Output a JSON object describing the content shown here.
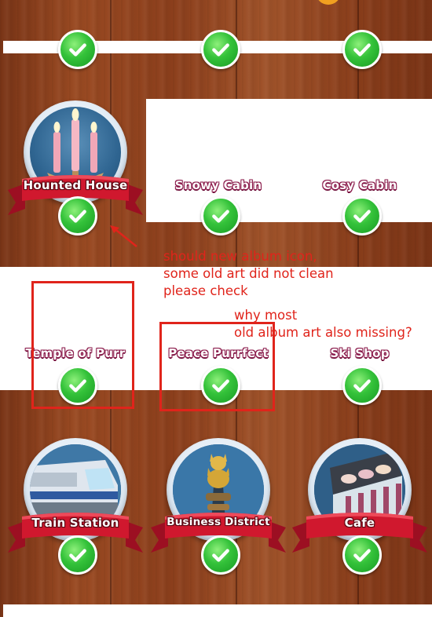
{
  "albums": {
    "row2": [
      {
        "title": "Hounted House",
        "completed": true,
        "icon": "candles-art"
      },
      {
        "title": "Snowy Cabin",
        "completed": true,
        "icon": ""
      },
      {
        "title": "Cosy Cabin",
        "completed": true,
        "icon": ""
      }
    ],
    "row3": [
      {
        "title": "Temple of Purr",
        "completed": true,
        "icon": ""
      },
      {
        "title": "Peace Purrfect",
        "completed": true,
        "icon": ""
      },
      {
        "title": "Ski Shop",
        "completed": true,
        "icon": ""
      }
    ],
    "row4": [
      {
        "title": "Train Station",
        "completed": true,
        "icon": "train-art"
      },
      {
        "title": "Business District",
        "completed": true,
        "icon": "cat-statue-art"
      },
      {
        "title": "Cafe",
        "completed": true,
        "icon": "cafe-art"
      }
    ]
  },
  "annotations": {
    "note1_line1": "should new album icon,",
    "note1_line2": "some old art did not clean",
    "note1_line3": "please check",
    "note2_line1": "why most",
    "note2_line2": "old album art also missing?"
  },
  "colors": {
    "annotation": "#e0241b",
    "ribbon": "#c8142a",
    "check": "#34c23a",
    "wood": "#8c3f1c"
  }
}
